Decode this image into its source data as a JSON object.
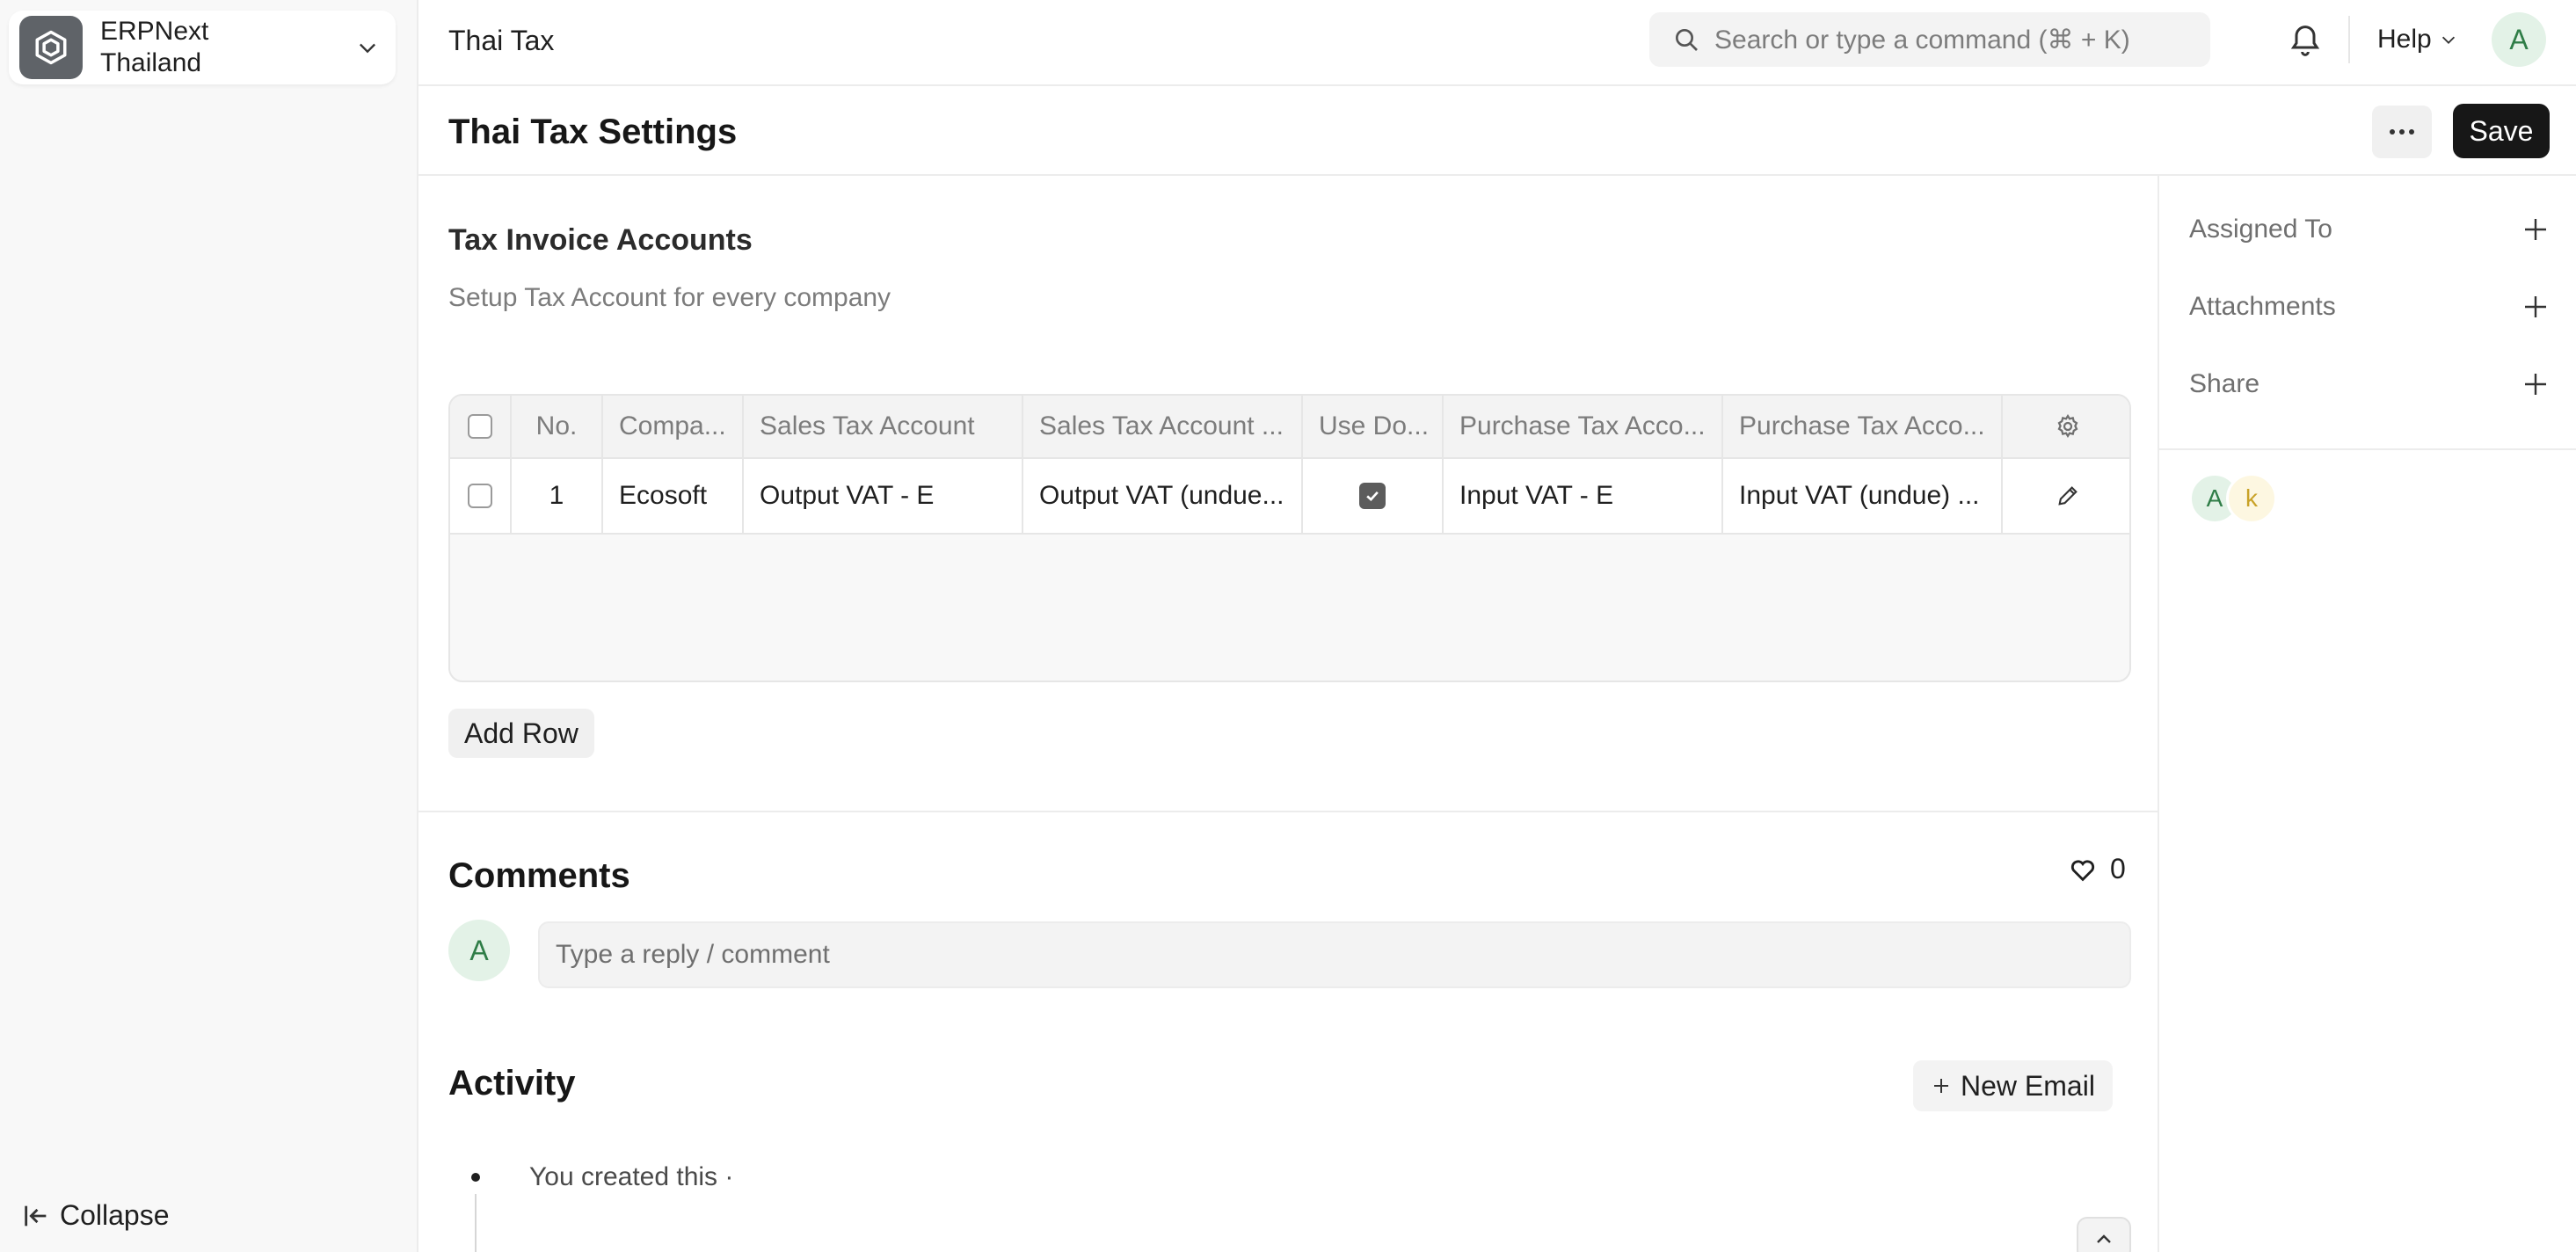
{
  "sidebar": {
    "workspace_name": "ERPNext\nThailand",
    "collapse_label": "Collapse"
  },
  "navbar": {
    "title": "Thai Tax",
    "search_placeholder": "Search or type a command (⌘ + K)",
    "help_label": "Help",
    "avatar_initial": "A"
  },
  "page": {
    "title": "Thai Tax Settings",
    "save_label": "Save"
  },
  "section": {
    "title": "Tax Invoice Accounts",
    "description": "Setup Tax Account for every company",
    "columns": [
      "No.",
      "Compa...",
      "Sales Tax Account",
      "Sales Tax Account ...",
      "Use Do...",
      "Purchase Tax Acco...",
      "Purchase Tax Acco..."
    ],
    "rows": [
      {
        "no": "1",
        "company": "Ecosoft",
        "sales_tax_account": "Output VAT - E",
        "sales_tax_account_undue": "Output VAT (undue...",
        "use_doc": true,
        "purchase_tax_account": "Input VAT - E",
        "purchase_tax_account_undue": "Input VAT (undue) ..."
      }
    ],
    "add_row_label": "Add Row"
  },
  "comments": {
    "title": "Comments",
    "likes": "0",
    "avatar_initial": "A",
    "input_placeholder": "Type a reply / comment"
  },
  "activity": {
    "title": "Activity",
    "new_email_label": "New Email",
    "items": [
      "You created this ·"
    ]
  },
  "side_panel": {
    "assigned_to": "Assigned To",
    "attachments": "Attachments",
    "share": "Share",
    "viewers": [
      "A",
      "k"
    ]
  },
  "colors": {
    "primary_button": "#171717",
    "avatar_green_bg": "#e3f2e7",
    "avatar_green_text": "#2f7d47"
  }
}
